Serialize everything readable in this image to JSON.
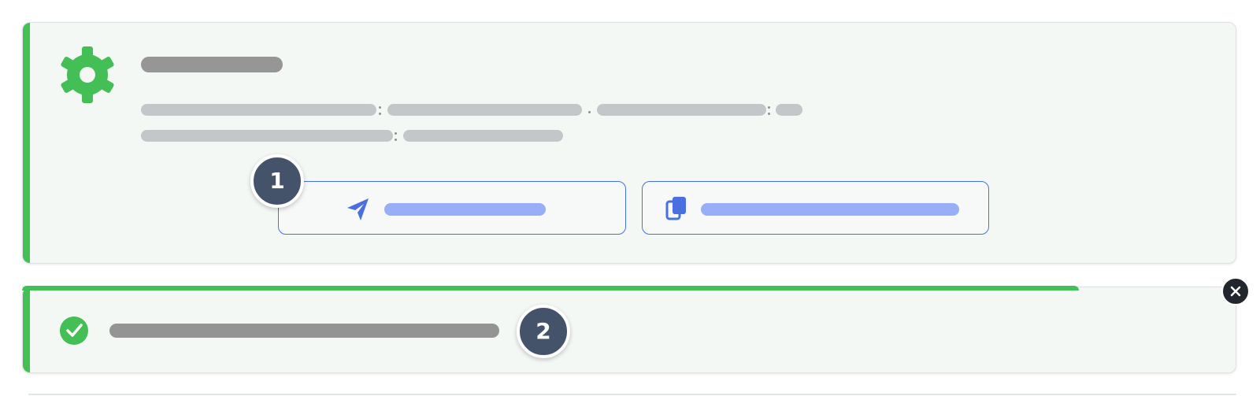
{
  "colors": {
    "accent_green": "#43bf55",
    "link_blue": "#4a6fe0",
    "badge_dark": "#44536a",
    "card_bg": "#f4f8f5"
  },
  "notification": {
    "icon": "gear-icon",
    "primary_action": {
      "icon": "send-icon"
    },
    "secondary_action": {
      "icon": "copy-icon"
    }
  },
  "badges": [
    "1",
    "2"
  ],
  "toast": {
    "icon": "check-circle-icon",
    "close_icon": "close-icon",
    "progress": 0.87
  }
}
